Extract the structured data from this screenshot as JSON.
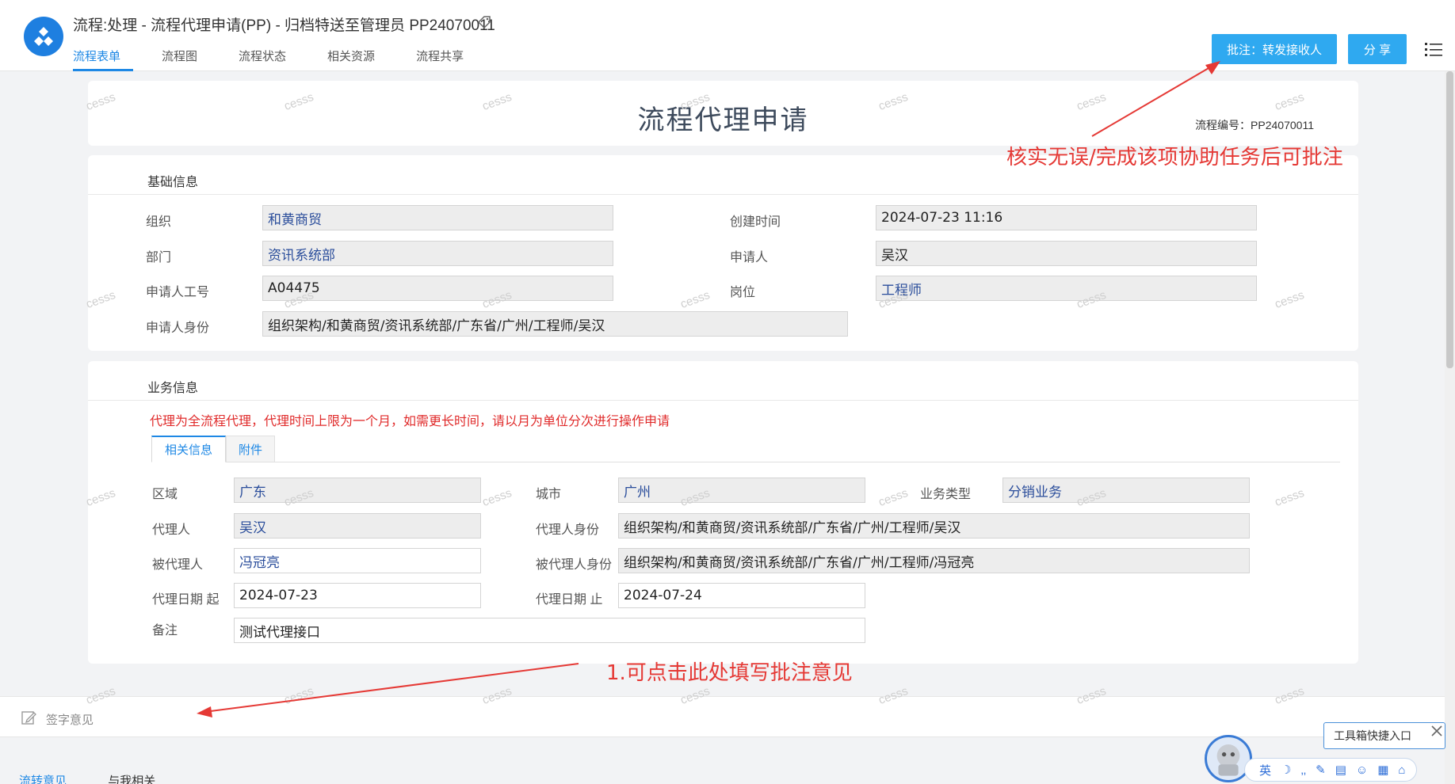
{
  "header": {
    "title": "流程:处理 - 流程代理申请(PP) - 归档特送至管理员 PP24070011",
    "tabs": [
      "流程表单",
      "流程图",
      "流程状态",
      "相关资源",
      "流程共享"
    ],
    "approve_button": "批注：转发接收人",
    "share_button": "分 享"
  },
  "document": {
    "title": "流程代理申请",
    "number": "流程编号：PP24070011"
  },
  "basic_info": {
    "section_title": "基础信息",
    "org_label": "组织",
    "org_value": "和黄商贸",
    "created_label": "创建时间",
    "created_value": "2024-07-23 11:16",
    "dept_label": "部门",
    "dept_value": "资讯系统部",
    "applicant_label": "申请人",
    "applicant_value": "吴汉",
    "empno_label": "申请人工号",
    "empno_value": "A04475",
    "post_label": "岗位",
    "post_value": "工程师",
    "identity_label": "申请人身份",
    "identity_value": "组织架构/和黄商贸/资讯系统部/广东省/广州/工程师/吴汉"
  },
  "business_info": {
    "section_title": "业务信息",
    "notice": "代理为全流程代理，代理时间上限为一个月，如需更长时间，请以月为单位分次进行操作申请",
    "tabs": [
      "相关信息",
      "附件"
    ],
    "region_label": "区域",
    "region_value": "广东",
    "city_label": "城市",
    "city_value": "广州",
    "biztype_label": "业务类型",
    "biztype_value": "分销业务",
    "agent_label": "代理人",
    "agent_value": "吴汉",
    "agent_identity_label": "代理人身份",
    "agent_identity_value": "组织架构/和黄商贸/资讯系统部/广东省/广州/工程师/吴汉",
    "principal_label": "被代理人",
    "principal_value": "冯冠亮",
    "principal_identity_label": "被代理人身份",
    "principal_identity_value": "组织架构/和黄商贸/资讯系统部/广东省/广州/工程师/冯冠亮",
    "start_label": "代理日期 起",
    "start_value": "2024-07-23",
    "end_label": "代理日期 止",
    "end_value": "2024-07-24",
    "remark_label": "备注",
    "remark_value": "测试代理接口"
  },
  "signature": {
    "placeholder": "签字意见"
  },
  "bottom_tabs": [
    "流转意见",
    "与我相关"
  ],
  "annotations": {
    "top": "核实无误/完成该项协助任务后可批注",
    "bottom": "1.可点击此处填写批注意见"
  },
  "toolbox": {
    "tip": "工具箱快捷入口",
    "ime_lang": "英"
  },
  "watermark": "cesss",
  "colors": {
    "accent": "#1e88e5",
    "button": "#2fa9f0",
    "annotation": "#e53935"
  }
}
